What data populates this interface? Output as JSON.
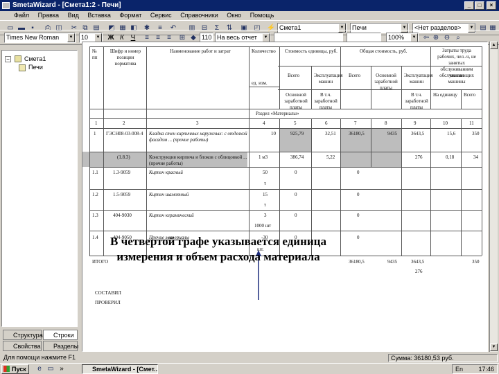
{
  "window": {
    "title": "SmetaWizard - [Сметa1:2 - Печи]"
  },
  "menu": [
    "Файл",
    "Правка",
    "Вид",
    "Вставка",
    "Формат",
    "Сервис",
    "Справочники",
    "Окно",
    "Помощь"
  ],
  "toolbar1": {
    "estimate_combo": "Смета1",
    "section_combo": "Печи",
    "divisions_combo": "<Нет разделов>"
  },
  "toolbar2": {
    "font": "Times New Roman",
    "size": "10",
    "row_value": "110",
    "row_name": "На весь отчет",
    "zoom": "100%"
  },
  "tree": {
    "root": "Смета1",
    "child": "Печи"
  },
  "left_tabs": [
    "Структура",
    "Строки",
    "Свойства",
    "Разделы"
  ],
  "table": {
    "h_num": "№ пп",
    "h_code": "Шифр и номер позиции норматива",
    "h_name": "Наименование работ и затрат",
    "h_qty": "Количество",
    "h_unitcost": "Стоимость единицы, руб.",
    "h_totalcost": "Общая стоимость, руб.",
    "h_labor": "Затраты труда рабочих, чел.-ч, не занятых обслуживанием машин",
    "h_all": "Всего",
    "h_mach": "Эксплуатация машин",
    "h_all2": "Всего",
    "h_basic": "Основной заработной платы",
    "h_mach2": "Эксплуатация машин",
    "h_serve": "обслуживающих машины",
    "h_unit": "ед. изм.",
    "h_basic_wage": "Основной заработной платы",
    "h_incl": "В т.ч. заработной платы",
    "h_incl2": "В т.ч. заработной платы",
    "h_per_unit": "На единицу",
    "h_total": "Всего",
    "section": "Раздел «Материалы»",
    "col_nums": [
      "1",
      "2",
      "3",
      "4",
      "5",
      "6",
      "7",
      "8",
      "9",
      "10",
      "11"
    ],
    "rows": [
      {
        "num": "1",
        "code": "ГЭСН08-03-008-4",
        "name": "Кладка стен кирпичных наружных: с отделкой фасадом ... (прочие работы)",
        "qty": "10",
        "unit": "",
        "c5": "925,79",
        "c6": "32,51",
        "c7": "36180,5",
        "c8": "9435",
        "c9": "3643,5",
        "c10": "15,6",
        "c11": "350"
      },
      {
        "num": "",
        "code": "(1.8.3)",
        "name": "Конструкция кирпича и блоков с облицовкой ... (прочие работы)",
        "qty": "1 м3",
        "unit": "",
        "c5": "386,74",
        "c6": "5,22",
        "c7": "",
        "c8": "",
        "c9": "276",
        "c10": "0,18",
        "c11": "34"
      },
      {
        "num": "1.1",
        "code": "1.3-9059",
        "name": "Кирпич красный",
        "qty": "50",
        "unit": "т",
        "c5": "0",
        "c6": "",
        "c7": "0",
        "c8": "",
        "c9": "",
        "c10": "",
        "c11": ""
      },
      {
        "num": "1.2",
        "code": "1.5-9059",
        "name": "Кирпич шамотный",
        "qty": "15",
        "unit": "т",
        "c5": "0",
        "c6": "",
        "c7": "0",
        "c8": "",
        "c9": "",
        "c10": "",
        "c11": ""
      },
      {
        "num": "1.3",
        "code": "404-9030",
        "name": "Кирпич керамический",
        "qty": "3",
        "unit": "1000 шт",
        "c5": "0",
        "c6": "",
        "c7": "0",
        "c8": "",
        "c9": "",
        "c10": "",
        "c11": ""
      },
      {
        "num": "1.4",
        "code": "404-9050",
        "name": "Прочие материалы",
        "qty": "-30",
        "unit": "шт.",
        "c5": "0",
        "c6": "",
        "c7": "0",
        "c8": "",
        "c9": "",
        "c10": "",
        "c11": ""
      }
    ],
    "total_label": "ИТОГО",
    "total": [
      "36180,5",
      "9435",
      "3643,5",
      "350"
    ],
    "total_sub": "276",
    "compiled": "СОСТАВИЛ",
    "checked": "ПРОВЕРИЛ"
  },
  "callout": {
    "line1": "В четвертой графе указывается единица",
    "line2": "измерения и объем расхода материала"
  },
  "status": {
    "hint": "Для помощи нажмите F1",
    "sum": "Сумма: 36180,53 руб."
  },
  "taskbar": {
    "start": "Пуск",
    "task": "SmetaWizard - [Смет...",
    "clock": "17:46",
    "lang": "En"
  }
}
